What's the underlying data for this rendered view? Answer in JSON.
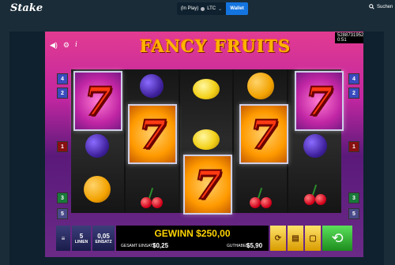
{
  "topbar": {
    "logo": "Stake",
    "balance": "(In Play)",
    "currency": "LTC",
    "wallet_label": "Wallet",
    "search_label": "Suchen"
  },
  "game": {
    "title": "FANCY FRUITS",
    "serial": "5288731952 0:51",
    "paylines_left": [
      "4",
      "2",
      "1",
      "3",
      "5"
    ],
    "paylines_right": [
      "4",
      "2",
      "1",
      "3",
      "5"
    ],
    "seven_glyph": "7",
    "bottom": {
      "lines_value": "5",
      "lines_label": "LINIEN",
      "bet_value": "0,05",
      "bet_label": "EINSATZ",
      "gewinn": "GEWINN $250,00",
      "total_bet_label": "GESAMT EINSATZ",
      "total_bet_value": "$0,25",
      "balance_label": "GUTHABEN",
      "balance_value": "$5,90"
    }
  },
  "colors": {
    "accent": "#1475e1",
    "background": "#1a2c38",
    "win_text": "#ffd400"
  }
}
